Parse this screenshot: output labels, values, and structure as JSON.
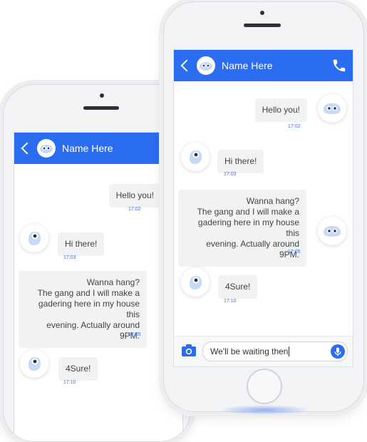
{
  "colors": {
    "accent": "#2b6df0",
    "bubble": "#f1f2f4",
    "time": "#3f6fd6"
  },
  "contact": {
    "name": "Name Here"
  },
  "icons": {
    "back": "chevron-left-icon",
    "call": "phone-icon",
    "camera": "camera-icon",
    "mic": "microphone-icon",
    "avatar": "robot-avatar-icon"
  },
  "messages": [
    {
      "from": "me",
      "text": "Hello you!",
      "time": "17:02"
    },
    {
      "from": "them",
      "text": "Hi there!",
      "time": "17:03"
    },
    {
      "from": "me",
      "lines": [
        "Wanna hang?",
        "The gang and I will make a",
        "gadering here in my house this",
        "evening. Actually around 9PM."
      ],
      "time": "17:05"
    },
    {
      "from": "them",
      "text": "4Sure!",
      "time": "17:10"
    }
  ],
  "composer": {
    "value": "We'll be waiting then"
  }
}
